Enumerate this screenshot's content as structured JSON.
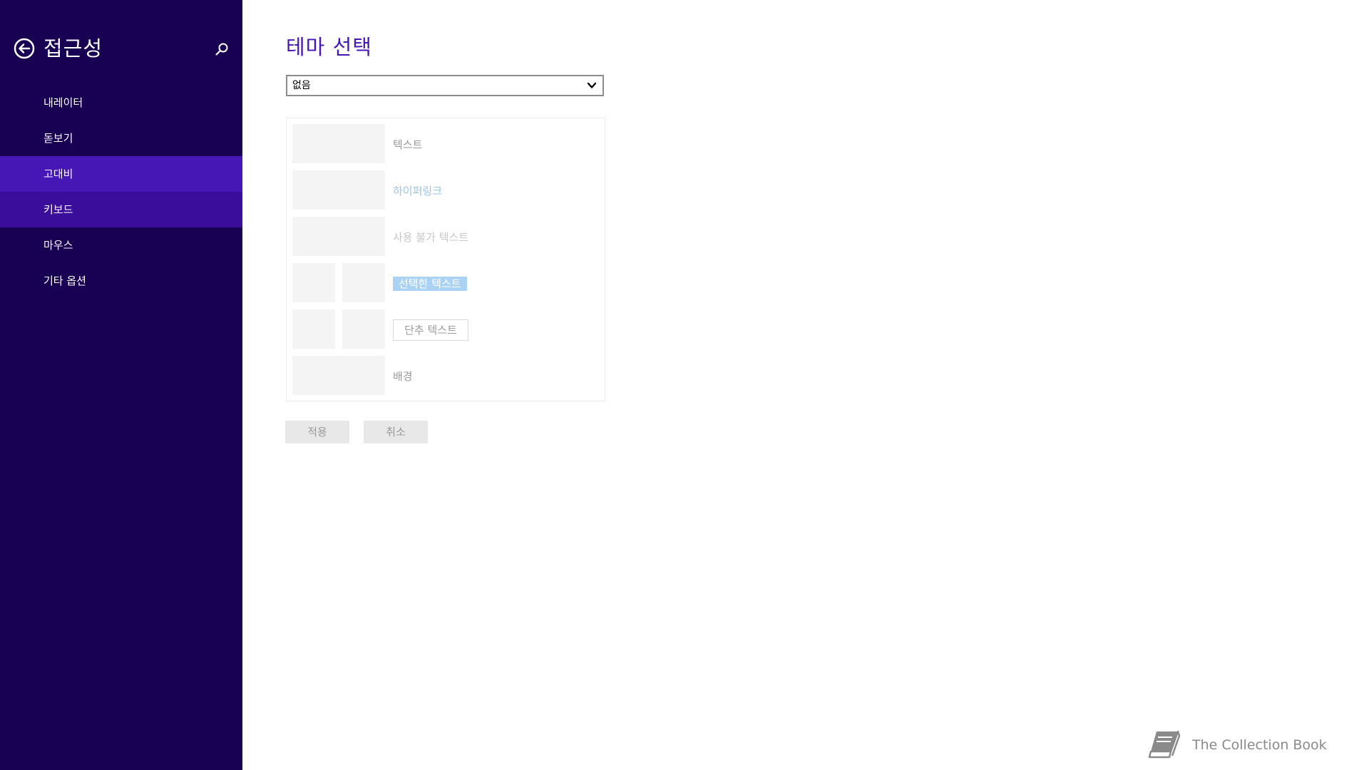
{
  "sidebar": {
    "title": "접근성",
    "items": [
      {
        "label": "내레이터"
      },
      {
        "label": "돋보기"
      },
      {
        "label": "고대비"
      },
      {
        "label": "키보드"
      },
      {
        "label": "마우스"
      },
      {
        "label": "기타 옵션"
      }
    ],
    "active_item": "고대비",
    "icons": {
      "back": "back-arrow-icon",
      "search": "search-icon"
    }
  },
  "main": {
    "title": "테마 선택",
    "theme_select": {
      "value": "없음"
    },
    "preview": {
      "text": "텍스트",
      "hyperlink": "하이퍼링크",
      "disabled_text": "사용 불가 텍스트",
      "selected_text": "선택한 텍스트",
      "button_text": "단추 텍스트",
      "background": "배경"
    },
    "buttons": {
      "apply": "적용",
      "cancel": "취소"
    }
  },
  "watermark": {
    "text": "The Collection Book"
  },
  "colors": {
    "sidebar_bg": "#180052",
    "sidebar_active": "#4617b4",
    "accent": "#4617b4",
    "hyperlink": "#9dc3e6",
    "selected_bg": "#a9d2f5"
  }
}
